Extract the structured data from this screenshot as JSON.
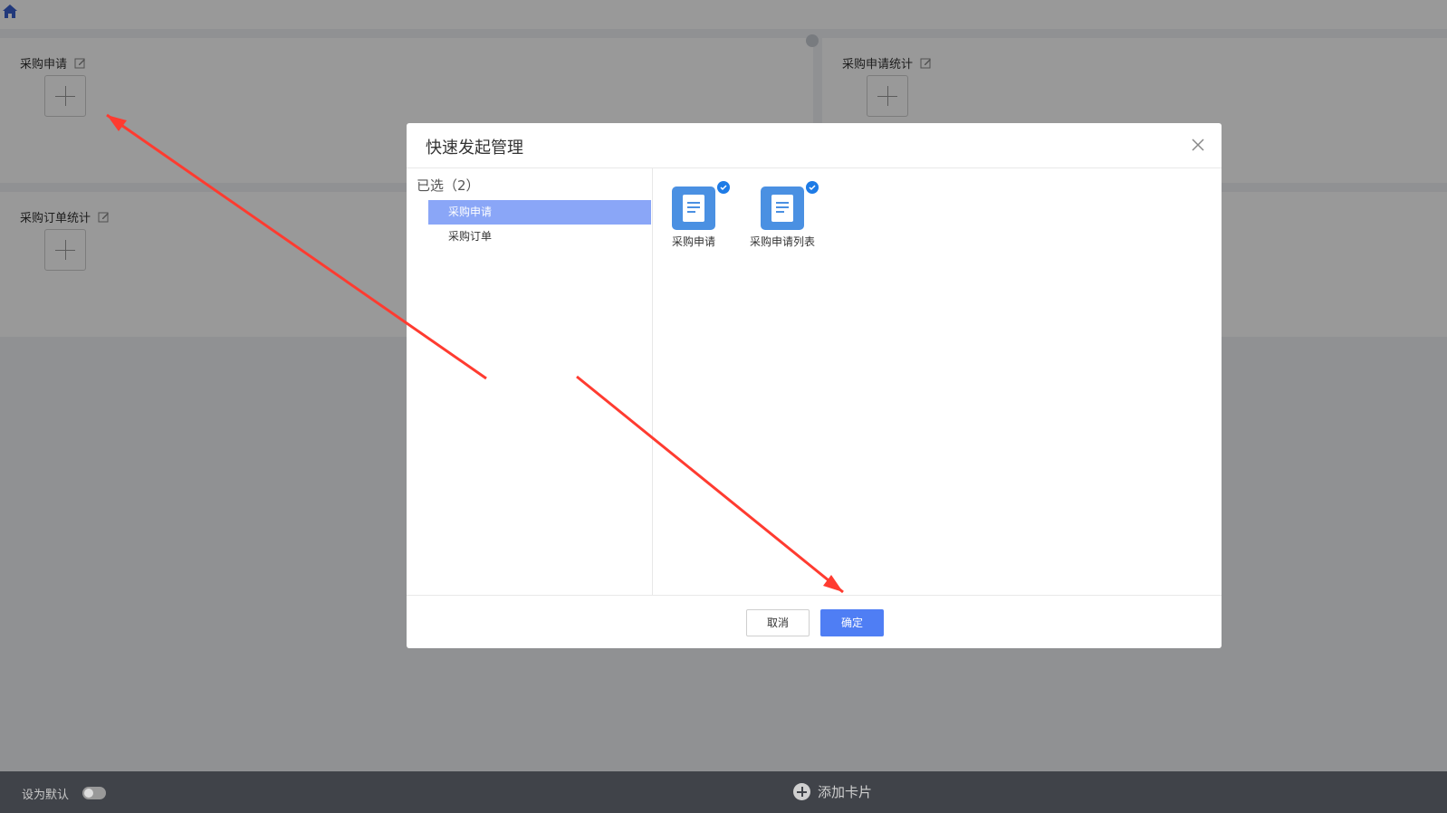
{
  "background": {
    "cards": [
      {
        "title": "采购申请"
      },
      {
        "title": "采购申请统计"
      },
      {
        "title": "采购订单统计"
      }
    ],
    "bottom_bar": {
      "default_label": "设为默认",
      "add_card_label": "添加卡片"
    }
  },
  "dialog": {
    "title": "快速发起管理",
    "selected_label": "已选（2）",
    "list": [
      {
        "label": "采购申请",
        "active": true
      },
      {
        "label": "采购订单",
        "active": false
      }
    ],
    "apps": [
      {
        "label": "采购申请",
        "checked": true
      },
      {
        "label": "采购申请列表",
        "checked": true
      }
    ],
    "buttons": {
      "cancel": "取消",
      "ok": "确定"
    }
  },
  "colors": {
    "primary": "#4f7ef4",
    "active_item": "#8aa6f7",
    "annotation_arrow": "#ff3b30"
  }
}
